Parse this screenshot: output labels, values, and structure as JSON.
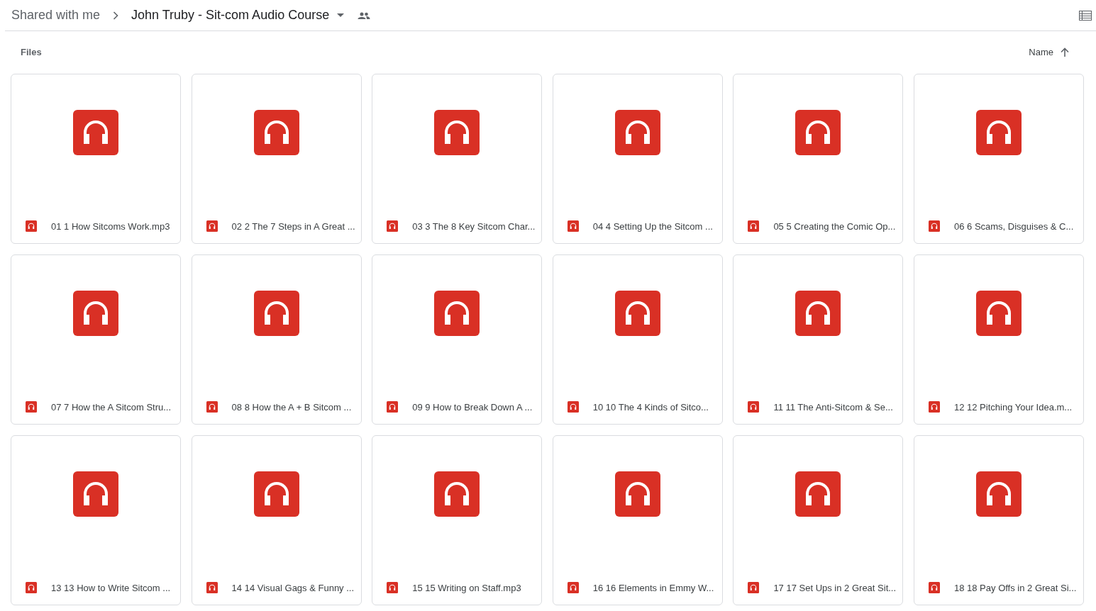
{
  "breadcrumb": {
    "parent": "Shared with me",
    "current": "John Truby - Sit-com Audio Course"
  },
  "section_title": "Files",
  "sort": {
    "label": "Name"
  },
  "files": [
    {
      "name": "01 1 How Sitcoms Work.mp3"
    },
    {
      "name": "02 2 The 7 Steps in A Great ..."
    },
    {
      "name": "03 3 The 8 Key Sitcom Char..."
    },
    {
      "name": "04 4 Setting Up the Sitcom ..."
    },
    {
      "name": "05 5 Creating the Comic Op..."
    },
    {
      "name": "06 6 Scams, Disguises & C..."
    },
    {
      "name": "07 7 How the A Sitcom Stru..."
    },
    {
      "name": "08 8 How the A + B Sitcom ..."
    },
    {
      "name": "09 9 How to Break Down A ..."
    },
    {
      "name": "10 10 The 4 Kinds of Sitco..."
    },
    {
      "name": "11 11 The Anti-Sitcom & Se..."
    },
    {
      "name": "12 12 Pitching Your Idea.m..."
    },
    {
      "name": "13 13 How to Write Sitcom ..."
    },
    {
      "name": "14 14 Visual Gags & Funny ..."
    },
    {
      "name": "15 15 Writing on Staff.mp3"
    },
    {
      "name": "16 16 Elements in Emmy W..."
    },
    {
      "name": "17 17 Set Ups in 2 Great Sit..."
    },
    {
      "name": "18 18 Pay Offs in 2 Great Si..."
    }
  ]
}
